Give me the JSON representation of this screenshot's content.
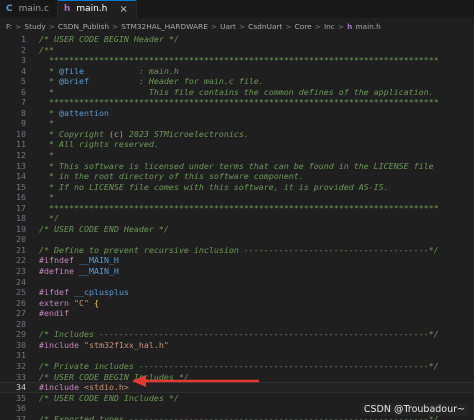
{
  "tabs": [
    {
      "icon": "C",
      "label": "main.c",
      "active": false
    },
    {
      "icon": "h",
      "label": "main.h",
      "active": true,
      "close": "×"
    }
  ],
  "breadcrumb": [
    "F:",
    "Study",
    "CSDN_Publish",
    "STM32HAL_HARDWARE",
    "Uart",
    "CsdnUart",
    "Core",
    "Inc",
    "main.h"
  ],
  "breadcrumb_sep": ">",
  "breadcrumb_file_icon": "h",
  "code_lines": [
    {
      "n": "1",
      "segs": [
        {
          "c": "com",
          "t": "/* USER CODE BEGIN Header */"
        }
      ]
    },
    {
      "n": "2",
      "segs": [
        {
          "c": "com",
          "t": "/**"
        }
      ]
    },
    {
      "n": "3",
      "segs": [
        {
          "c": "com",
          "t": "  ******************************************************************************"
        }
      ]
    },
    {
      "n": "4",
      "segs": [
        {
          "c": "com",
          "t": "  * "
        },
        {
          "c": "tag",
          "t": "@file"
        },
        {
          "c": "com",
          "t": "           : main.h"
        }
      ]
    },
    {
      "n": "5",
      "segs": [
        {
          "c": "com",
          "t": "  * "
        },
        {
          "c": "tag",
          "t": "@brief"
        },
        {
          "c": "com",
          "t": "          : Header for main.c file."
        }
      ]
    },
    {
      "n": "6",
      "segs": [
        {
          "c": "com",
          "t": "  *                   This file contains the common defines of the application."
        }
      ]
    },
    {
      "n": "7",
      "segs": [
        {
          "c": "com",
          "t": "  ******************************************************************************"
        }
      ]
    },
    {
      "n": "8",
      "segs": [
        {
          "c": "com",
          "t": "  * "
        },
        {
          "c": "tag",
          "t": "@attention"
        }
      ]
    },
    {
      "n": "9",
      "segs": [
        {
          "c": "com",
          "t": "  *"
        }
      ]
    },
    {
      "n": "10",
      "segs": [
        {
          "c": "com",
          "t": "  * Copyright "
        },
        {
          "c": "link",
          "t": "(c)"
        },
        {
          "c": "com",
          "t": " 2023 STMicroelectronics."
        }
      ]
    },
    {
      "n": "11",
      "segs": [
        {
          "c": "com",
          "t": "  * All rights reserved."
        }
      ]
    },
    {
      "n": "12",
      "segs": [
        {
          "c": "com",
          "t": "  *"
        }
      ]
    },
    {
      "n": "13",
      "segs": [
        {
          "c": "com",
          "t": "  * This software is licensed under terms that can be found in the LICENSE file"
        }
      ]
    },
    {
      "n": "14",
      "segs": [
        {
          "c": "com",
          "t": "  * in the root directory of this software component."
        }
      ]
    },
    {
      "n": "15",
      "segs": [
        {
          "c": "com",
          "t": "  * If no LICENSE file comes with this software, it is provided AS-IS."
        }
      ]
    },
    {
      "n": "16",
      "segs": [
        {
          "c": "com",
          "t": "  *"
        }
      ]
    },
    {
      "n": "17",
      "segs": [
        {
          "c": "com",
          "t": "  ******************************************************************************"
        }
      ]
    },
    {
      "n": "18",
      "segs": [
        {
          "c": "com",
          "t": "  */"
        }
      ]
    },
    {
      "n": "19",
      "segs": [
        {
          "c": "com",
          "t": "/* USER CODE END Header */"
        }
      ]
    },
    {
      "n": "20",
      "segs": []
    },
    {
      "n": "21",
      "segs": [
        {
          "c": "com",
          "t": "/* Define to prevent recursive inclusion -------------------------------------*/"
        }
      ]
    },
    {
      "n": "22",
      "segs": [
        {
          "c": "dir",
          "t": "#ifndef"
        },
        {
          "c": "plain",
          "t": " "
        },
        {
          "c": "macro",
          "t": "__MAIN_H"
        }
      ]
    },
    {
      "n": "23",
      "segs": [
        {
          "c": "dir",
          "t": "#define"
        },
        {
          "c": "plain",
          "t": " "
        },
        {
          "c": "macro",
          "t": "__MAIN_H"
        }
      ]
    },
    {
      "n": "24",
      "segs": []
    },
    {
      "n": "25",
      "segs": [
        {
          "c": "dir",
          "t": "#ifdef"
        },
        {
          "c": "plain",
          "t": " "
        },
        {
          "c": "macro",
          "t": "__cplusplus"
        }
      ]
    },
    {
      "n": "26",
      "segs": [
        {
          "c": "kw",
          "t": "extern"
        },
        {
          "c": "plain",
          "t": " "
        },
        {
          "c": "str",
          "t": "\"C\""
        },
        {
          "c": "plain",
          "t": " "
        },
        {
          "c": "brace",
          "t": "{"
        }
      ]
    },
    {
      "n": "27",
      "segs": [
        {
          "c": "dir",
          "t": "#endif"
        }
      ]
    },
    {
      "n": "28",
      "segs": []
    },
    {
      "n": "29",
      "segs": [
        {
          "c": "com",
          "t": "/* Includes ------------------------------------------------------------------*/"
        }
      ]
    },
    {
      "n": "30",
      "segs": [
        {
          "c": "dir",
          "t": "#include"
        },
        {
          "c": "plain",
          "t": " "
        },
        {
          "c": "str",
          "t": "\"stm32f1xx_hal.h\""
        }
      ]
    },
    {
      "n": "31",
      "segs": []
    },
    {
      "n": "32",
      "segs": [
        {
          "c": "com",
          "t": "/* Private includes ----------------------------------------------------------*/"
        }
      ]
    },
    {
      "n": "33",
      "segs": [
        {
          "c": "com",
          "t": "/* USER CODE BEGIN Includes */"
        }
      ]
    },
    {
      "n": "34",
      "segs": [
        {
          "c": "dir",
          "t": "#include"
        },
        {
          "c": "plain",
          "t": " "
        },
        {
          "c": "str",
          "t": "<stdio.h>"
        }
      ],
      "current": true
    },
    {
      "n": "35",
      "segs": [
        {
          "c": "com",
          "t": "/* USER CODE END Includes */"
        }
      ]
    },
    {
      "n": "36",
      "segs": []
    },
    {
      "n": "37",
      "segs": [
        {
          "c": "com",
          "t": "/* Exported types ------------------------------------------------------------*/"
        }
      ]
    }
  ],
  "watermark": "CSDN @Troubadour~",
  "colors": {
    "accent": "#0078d4",
    "arrow": "#e53935"
  },
  "icons": {
    "c_file": "c-file-icon",
    "h_file": "h-file-icon",
    "close": "close-icon",
    "arrow": "annotation-arrow"
  }
}
